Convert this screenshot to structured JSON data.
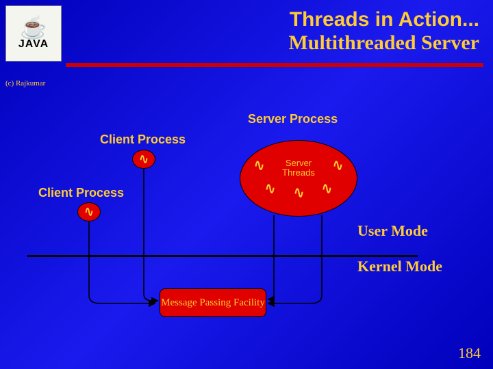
{
  "copyright": "(c) Rajkumar",
  "title_line1": "Threads in Action...",
  "title_line2": "Multithreaded Server",
  "labels": {
    "client1": "Client Process",
    "client2": "Client Process",
    "server": "Server Process",
    "server_threads": "Server\nThreads",
    "user_mode": "User\nMode",
    "kernel_mode": "Kernel\nMode",
    "message_box": "Message Passing\nFacility"
  },
  "logo_text": "JAVA",
  "slide_number": "184"
}
